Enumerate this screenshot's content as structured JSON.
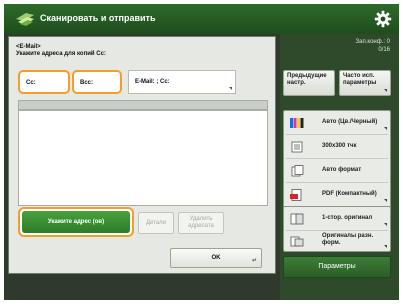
{
  "window": {
    "title": "Сканировать и отправить"
  },
  "status": {
    "counter_line1": "Зап.конф.: 0",
    "counter_line2": "0/16"
  },
  "dialog": {
    "header_line1": "<E-Mail>",
    "header_line2": "Укажите адреса для копий Cc:",
    "tabs": [
      {
        "label": "Cc:"
      },
      {
        "label": "Bcc:"
      },
      {
        "label": "E-Mail: ; Cc:"
      }
    ],
    "buttons": {
      "specify_address": "Укажите адрес (ов)",
      "details": "Детали",
      "delete_address_line1": "Удалить",
      "delete_address_line2": "адресата",
      "ok": "OK"
    }
  },
  "right_panel": {
    "prev_settings_line1": "Предыдущие",
    "prev_settings_line2": "настр.",
    "options_line1": "Часто исп.",
    "options_line2": "параметры",
    "rows": [
      {
        "label": "Авто (Цв./Черный)",
        "icon": "color-mode-icon"
      },
      {
        "label": "300x300 тчк",
        "icon": "resolution-icon"
      },
      {
        "label": "Авто формат",
        "icon": "format-icon"
      },
      {
        "label": "PDF (Компактный)",
        "icon": "pdf-icon"
      }
    ],
    "duplex": "1-стор. оригинал",
    "original_size_line1": "Оригиналы разн.",
    "original_size_line2": "форм.",
    "parameters": "Параметры"
  },
  "colors": {
    "title_bar": "#2e6a2a",
    "highlight": "#f0a02a",
    "green_button": "#47a23f"
  }
}
